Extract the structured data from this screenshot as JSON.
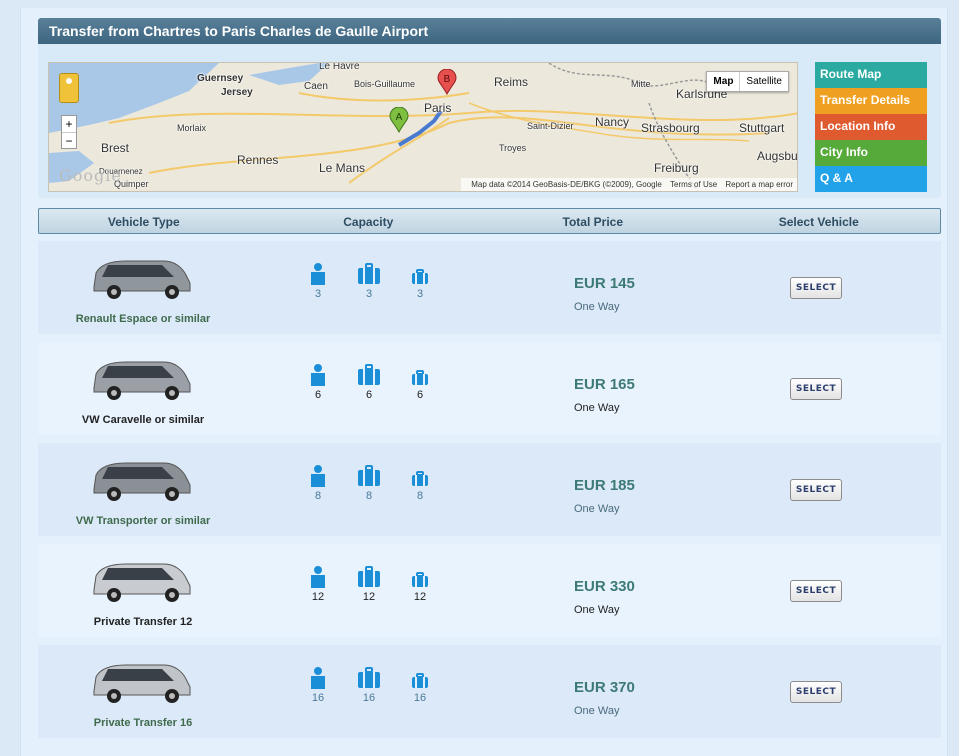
{
  "panel": {
    "title": "Transfer from Chartres to Paris Charles de Gaulle Airport"
  },
  "map": {
    "toggle_map": "Map",
    "toggle_satellite": "Satellite",
    "logo": "Google",
    "zoom_in": "+",
    "zoom_out": "−",
    "attribution": "Map data ©2014 GeoBasis-DE/BKG (©2009), Google",
    "terms": "Terms of Use",
    "report": "Report a map error",
    "marker_a": "A",
    "marker_b": "B",
    "labels": {
      "guernsey": "Guernsey",
      "jersey": "Jersey",
      "le_havre": "Le Havre",
      "caen": "Caen",
      "bois_guillaume": "Bois-Guillaume",
      "reims": "Reims",
      "mitte": "Mitte",
      "karlsruhe": "Karlsruhe",
      "morlaix": "Morlaix",
      "brest": "Brest",
      "paris": "Paris",
      "saint_dizier": "Saint-Dizier",
      "nancy": "Nancy",
      "strasbourg": "Strasbourg",
      "stuttgart": "Stuttgart",
      "rennes": "Rennes",
      "le_mans": "Le Mans",
      "troyes": "Troyes",
      "augsburg": "Augsbu",
      "douarnenez": "Douarnenez",
      "quimper": "Quimper",
      "freiburg": "Freiburg"
    }
  },
  "side_nav": [
    {
      "label": "Route Map",
      "color": "#2aaaa0"
    },
    {
      "label": "Transfer Details",
      "color": "#f0a020"
    },
    {
      "label": "Location Info",
      "color": "#e05a30"
    },
    {
      "label": "City Info",
      "color": "#55aa3a"
    },
    {
      "label": "Q & A",
      "color": "#22a2e8"
    }
  ],
  "table": {
    "headers": [
      "Vehicle Type",
      "Capacity",
      "Total Price",
      "Select Vehicle"
    ],
    "rows": [
      {
        "vehicle": "Renault Espace or similar",
        "passengers": "3",
        "large_bags": "3",
        "small_bags": "3",
        "price": "EUR 145",
        "trip": "One Way",
        "button": "SELECT"
      },
      {
        "vehicle": "VW Caravelle or similar",
        "passengers": "6",
        "large_bags": "6",
        "small_bags": "6",
        "price": "EUR 165",
        "trip": "One Way",
        "button": "SELECT"
      },
      {
        "vehicle": "VW Transporter or similar",
        "passengers": "8",
        "large_bags": "8",
        "small_bags": "8",
        "price": "EUR 185",
        "trip": "One Way",
        "button": "SELECT"
      },
      {
        "vehicle": "Private Transfer 12",
        "passengers": "12",
        "large_bags": "12",
        "small_bags": "12",
        "price": "EUR 330",
        "trip": "One Way",
        "button": "SELECT"
      },
      {
        "vehicle": "Private Transfer 16",
        "passengers": "16",
        "large_bags": "16",
        "small_bags": "16",
        "price": "EUR 370",
        "trip": "One Way",
        "button": "SELECT"
      }
    ]
  },
  "colors": {
    "header_bar": "#3d6680",
    "capacity_icon": "#1a8fd8",
    "price_text": "#3d7a76",
    "button_text": "#2d3f6e"
  }
}
